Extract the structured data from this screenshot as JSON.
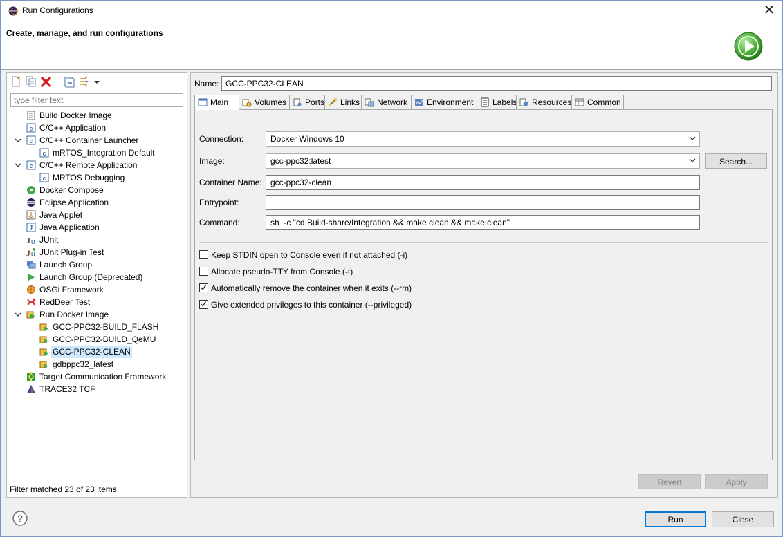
{
  "window": {
    "title": "Run Configurations",
    "close_glyph": "✕",
    "banner_title": "Create, manage, and run configurations",
    "banner_icon": "run-play-icon"
  },
  "left": {
    "toolbar": [
      "new-config-icon",
      "duplicate-icon",
      "delete-icon",
      "collapse-all-icon",
      "filter-icon",
      "dropdown-arrow-icon"
    ],
    "filter_placeholder": "type filter text",
    "tree": [
      {
        "label": "Build Docker Image",
        "level": 0,
        "icon": "docker-build-icon"
      },
      {
        "label": "C/C++ Application",
        "level": 0,
        "icon": "c-app-icon"
      },
      {
        "label": "C/C++ Container Launcher",
        "level": 0,
        "icon": "c-app-icon",
        "expanded": true
      },
      {
        "label": "mRTOS_Integration Default",
        "level": 1,
        "icon": "c-app-icon"
      },
      {
        "label": "C/C++ Remote Application",
        "level": 0,
        "icon": "c-app-icon",
        "expanded": true
      },
      {
        "label": "MRTOS Debugging",
        "level": 1,
        "icon": "c-app-icon"
      },
      {
        "label": "Docker Compose",
        "level": 0,
        "icon": "docker-compose-icon"
      },
      {
        "label": "Eclipse Application",
        "level": 0,
        "icon": "eclipse-icon"
      },
      {
        "label": "Java Applet",
        "level": 0,
        "icon": "java-applet-icon"
      },
      {
        "label": "Java Application",
        "level": 0,
        "icon": "java-app-icon"
      },
      {
        "label": "JUnit",
        "level": 0,
        "icon": "junit-icon"
      },
      {
        "label": "JUnit Plug-in Test",
        "level": 0,
        "icon": "junit-plugin-icon"
      },
      {
        "label": "Launch Group",
        "level": 0,
        "icon": "launch-group-icon"
      },
      {
        "label": "Launch Group (Deprecated)",
        "level": 0,
        "icon": "launch-group-deprecated-icon"
      },
      {
        "label": "OSGi Framework",
        "level": 0,
        "icon": "osgi-icon"
      },
      {
        "label": "RedDeer Test",
        "level": 0,
        "icon": "reddeer-icon"
      },
      {
        "label": "Run Docker Image",
        "level": 0,
        "icon": "docker-run-icon",
        "expanded": true
      },
      {
        "label": "GCC-PPC32-BUILD_FLASH",
        "level": 1,
        "icon": "docker-run-icon"
      },
      {
        "label": "GCC-PPC32-BUILD_QeMU",
        "level": 1,
        "icon": "docker-run-icon"
      },
      {
        "label": "GCC-PPC32-CLEAN",
        "level": 1,
        "icon": "docker-run-icon",
        "selected": true
      },
      {
        "label": "gdbppc32_latest",
        "level": 1,
        "icon": "docker-run-icon"
      },
      {
        "label": "Target Communication Framework",
        "level": 0,
        "icon": "tcf-icon"
      },
      {
        "label": "TRACE32 TCF",
        "level": 0,
        "icon": "trace32-icon"
      }
    ],
    "status": "Filter matched 23 of 23 items"
  },
  "right": {
    "name_label": "Name:",
    "name_value": "GCC-PPC32-CLEAN",
    "tabs": [
      {
        "label": "Main",
        "icon": "main-tab-icon",
        "active": true
      },
      {
        "label": "Volumes",
        "icon": "volumes-icon"
      },
      {
        "label": "Ports",
        "icon": "ports-icon"
      },
      {
        "label": "Links",
        "icon": "links-icon"
      },
      {
        "label": "Network",
        "icon": "network-icon"
      },
      {
        "label": "Environment",
        "icon": "environment-icon"
      },
      {
        "label": "Labels",
        "icon": "labels-icon"
      },
      {
        "label": "Resources",
        "icon": "resources-icon"
      },
      {
        "label": "Common",
        "icon": "common-icon"
      }
    ],
    "connection_label": "Connection:",
    "connection_value": "Docker Windows 10",
    "image_label": "Image:",
    "image_value": "gcc-ppc32:latest",
    "search_label": "Search...",
    "container_name_label": "Container Name:",
    "container_name_value": "gcc-ppc32-clean",
    "entrypoint_label": "Entrypoint:",
    "entrypoint_value": "",
    "command_label": "Command:",
    "command_value": "sh  -c \"cd Build-share/Integration && make clean && make clean\"",
    "checkboxes": [
      {
        "label": "Keep STDIN open to Console even if not attached (-i)",
        "checked": false
      },
      {
        "label": "Allocate pseudo-TTY from Console (-t)",
        "checked": false
      },
      {
        "label": "Automatically remove the container when it exits (--rm)",
        "checked": true
      },
      {
        "label": "Give extended privileges to this container (--privileged)",
        "checked": true
      }
    ],
    "revert_label": "Revert",
    "apply_label": "Apply"
  },
  "footer": {
    "help_icon": "help-icon",
    "help_glyph": "?",
    "run_label": "Run",
    "close_label": "Close"
  }
}
